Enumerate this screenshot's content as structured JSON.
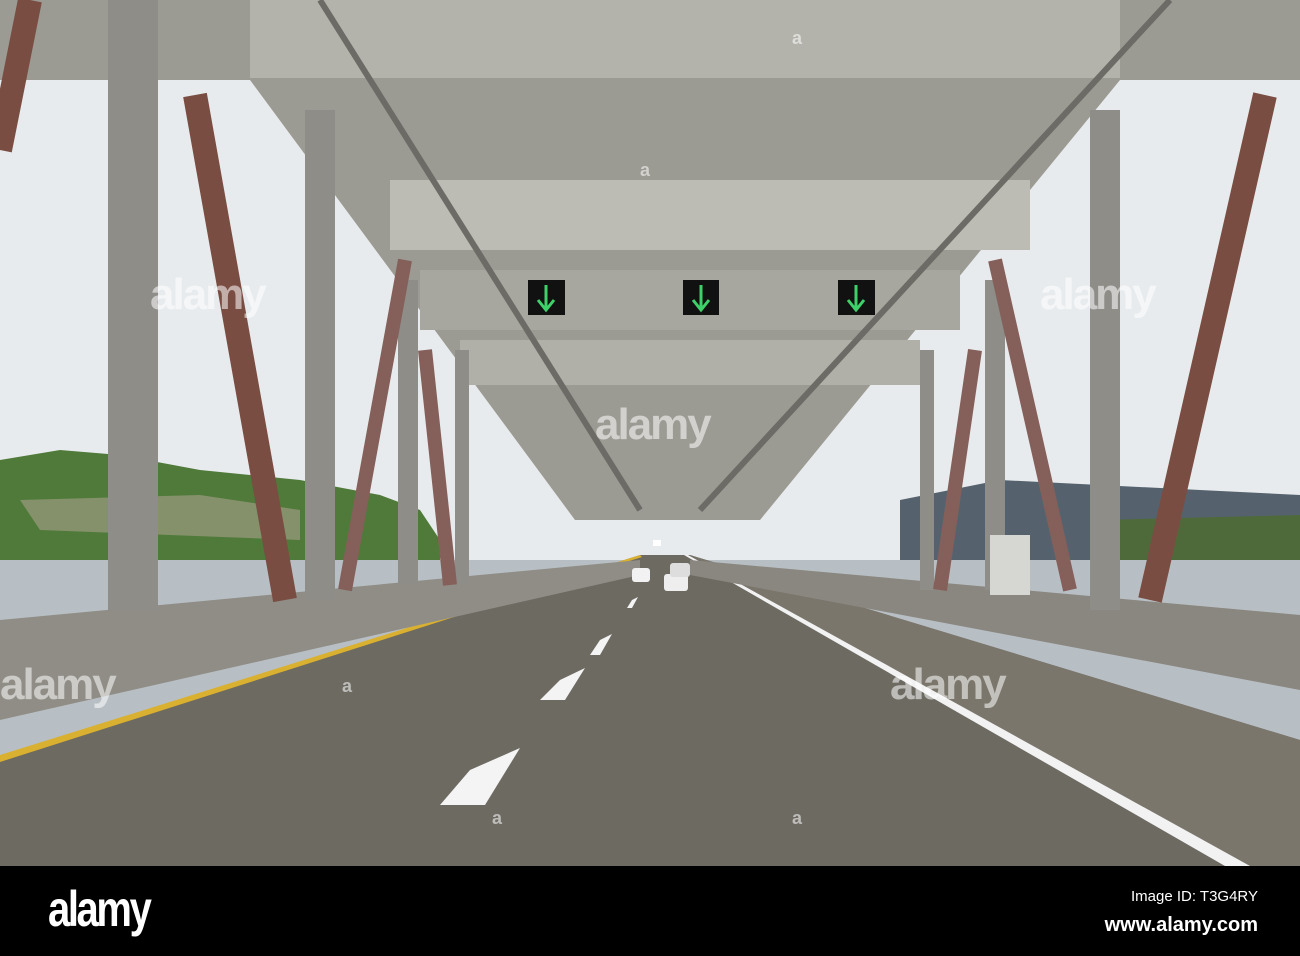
{
  "photo": {
    "subject": "bridge-deck-road",
    "colors": {
      "sky": "#e9ecee",
      "steel": "#9a9a94",
      "rust": "#8a5a4a",
      "road": "#6d6a62",
      "sign_arrow": "#3ed16a",
      "hill": "#4f7a3a",
      "water": "#b9c0c5"
    }
  },
  "watermark": {
    "text": "alamy",
    "mark": "a"
  },
  "footer": {
    "logo": "alamy",
    "image_id": "Image ID: T3G4RY",
    "website": "www.alamy.com"
  }
}
